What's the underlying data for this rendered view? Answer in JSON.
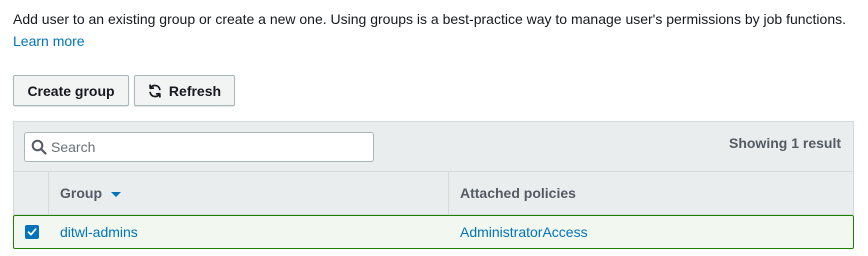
{
  "intro": {
    "text": "Add user to an existing group or create a new one. Using groups is a best-practice way to manage user's permissions by job functions.",
    "learn_more": "Learn more"
  },
  "toolbar": {
    "create_group_label": "Create group",
    "refresh_label": "Refresh",
    "refresh_icon": "refresh-icon"
  },
  "search": {
    "placeholder": "Search",
    "value": "",
    "icon": "search-icon"
  },
  "results": {
    "count_text": "Showing 1 result"
  },
  "table": {
    "columns": [
      {
        "label": "Group",
        "sorted": "descending"
      },
      {
        "label": "Attached policies"
      }
    ],
    "rows": [
      {
        "selected": true,
        "group": "ditwl-admins",
        "policies": "AdministratorAccess"
      }
    ]
  },
  "colors": {
    "link": "#0073bb",
    "selected_row_border": "#1d8102",
    "selected_row_bg": "#f2f8f0",
    "header_bg": "#eaeded"
  }
}
